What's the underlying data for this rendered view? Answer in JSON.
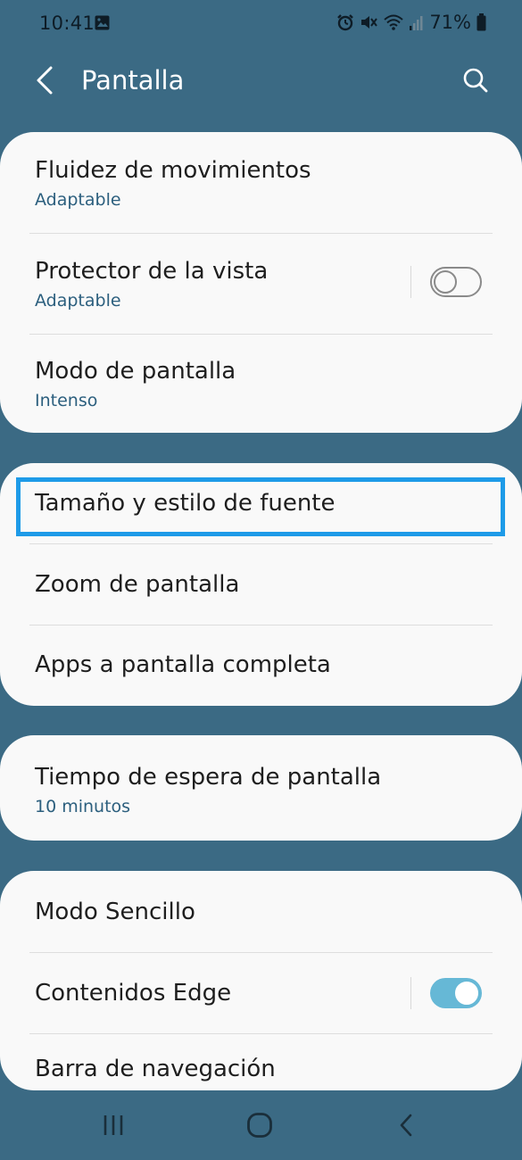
{
  "status_bar": {
    "time": "10:41",
    "battery": "71%"
  },
  "header": {
    "title": "Pantalla"
  },
  "colors": {
    "background": "#3b6a84",
    "card": "#f9f9f9",
    "subtitle": "#2c5f7e",
    "toggle_on": "#66b8d6",
    "highlight": "#1e9be8"
  },
  "cards": [
    {
      "items": [
        {
          "title": "Fluidez de movimientos",
          "subtitle": "Adaptable"
        },
        {
          "title": "Protector de la vista",
          "subtitle": "Adaptable",
          "toggle": "off"
        },
        {
          "title": "Modo de pantalla",
          "subtitle": "Intenso"
        }
      ]
    },
    {
      "items": [
        {
          "title": "Tamaño y estilo de fuente",
          "highlighted": true
        },
        {
          "title": "Zoom de pantalla"
        },
        {
          "title": "Apps a pantalla completa"
        }
      ]
    },
    {
      "items": [
        {
          "title": "Tiempo de espera de pantalla",
          "subtitle": "10 minutos"
        }
      ]
    },
    {
      "items": [
        {
          "title": "Modo Sencillo"
        },
        {
          "title": "Contenidos Edge",
          "toggle": "on"
        },
        {
          "title": "Barra de navegación"
        }
      ]
    }
  ],
  "icons": {
    "back": "back-arrow-icon",
    "search": "search-icon",
    "nav_recents": "recents-icon",
    "nav_home": "home-icon",
    "nav_back": "nav-back-icon"
  }
}
